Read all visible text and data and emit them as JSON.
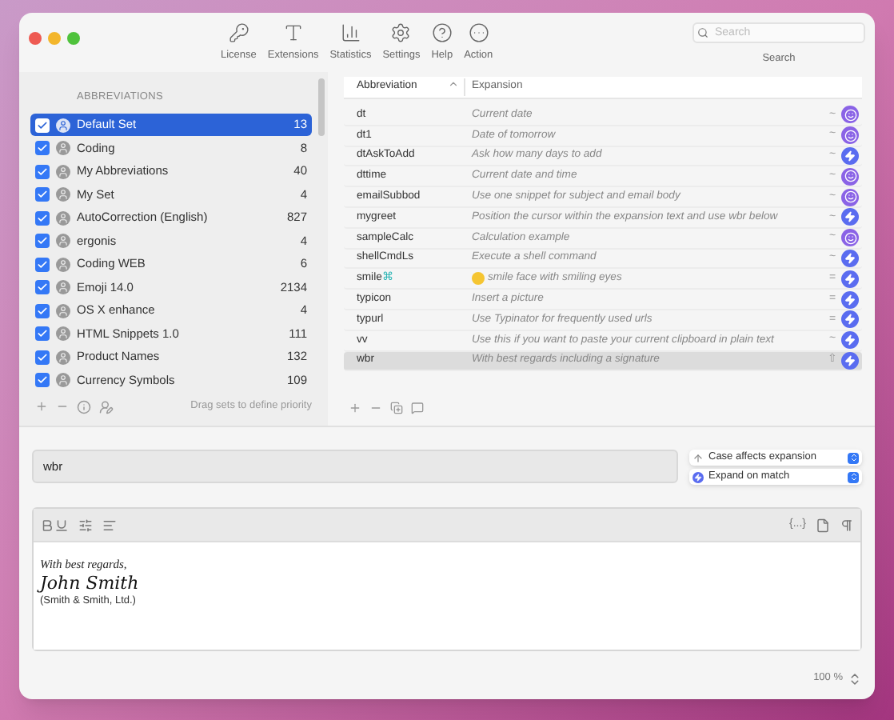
{
  "toolbar": [
    {
      "label": "License",
      "kind": "key"
    },
    {
      "label": "Extensions",
      "kind": "text"
    },
    {
      "label": "Statistics",
      "kind": "chart"
    },
    {
      "label": "Settings",
      "kind": "gear"
    },
    {
      "label": "Help",
      "kind": "help"
    },
    {
      "label": "Action",
      "kind": "action"
    }
  ],
  "search": {
    "placeholder": "Search",
    "label": "Search"
  },
  "sets": {
    "header": "ABBREVIATIONS",
    "items": [
      {
        "name": "Default Set",
        "count": "13",
        "checked": true,
        "selected": true
      },
      {
        "name": "Coding",
        "count": "8",
        "checked": true,
        "selected": false
      },
      {
        "name": "My Abbreviations",
        "count": "40",
        "checked": true,
        "selected": false
      },
      {
        "name": "My Set",
        "count": "4",
        "checked": true,
        "selected": false
      },
      {
        "name": "AutoCorrection (English)",
        "count": "827",
        "checked": true,
        "selected": false
      },
      {
        "name": "ergonis",
        "count": "4",
        "checked": true,
        "selected": false
      },
      {
        "name": "Coding WEB",
        "count": "6",
        "checked": true,
        "selected": false
      },
      {
        "name": "Emoji 14.0",
        "count": "2134",
        "checked": true,
        "selected": false
      },
      {
        "name": "OS X enhance",
        "count": "4",
        "checked": true,
        "selected": false
      },
      {
        "name": "HTML Snippets 1.0",
        "count": "111",
        "checked": true,
        "selected": false
      },
      {
        "name": "Product Names",
        "count": "132",
        "checked": true,
        "selected": false
      },
      {
        "name": "Currency Symbols",
        "count": "109",
        "checked": true,
        "selected": false
      }
    ],
    "hint": "Drag sets to define priority"
  },
  "table": {
    "columns": [
      "Abbreviation",
      "Expansion"
    ],
    "rows": [
      {
        "abbreviation": "dt",
        "expansion": "Current date",
        "mode": "~",
        "kind": "script",
        "selected": false
      },
      {
        "abbreviation": "dt1",
        "expansion": "Date of tomorrow",
        "mode": "~",
        "kind": "script",
        "selected": false
      },
      {
        "abbreviation": "dtAskToAdd",
        "expansion": "Ask how many days to add",
        "mode": "~",
        "kind": "bolt",
        "selected": false
      },
      {
        "abbreviation": "dttime",
        "expansion": "Current date and time",
        "mode": "~",
        "kind": "script",
        "selected": false
      },
      {
        "abbreviation": "emailSubbod",
        "expansion": "Use one snippet for subject and email body",
        "mode": "~",
        "kind": "script",
        "selected": false
      },
      {
        "abbreviation": "mygreet",
        "expansion": "Position the cursor within the expansion text and use wbr below",
        "mode": "~",
        "kind": "bolt",
        "selected": false
      },
      {
        "abbreviation": "sampleCalc",
        "expansion": "Calculation example",
        "mode": "~",
        "kind": "script",
        "selected": false
      },
      {
        "abbreviation": "shellCmdLs",
        "expansion": "Execute a shell command",
        "mode": "~",
        "kind": "bolt",
        "selected": false
      },
      {
        "abbreviation": "smile",
        "mark": "⌘",
        "emoji": true,
        "expansion": "smile face with smiling eyes",
        "mode": "=",
        "kind": "bolt",
        "selected": false
      },
      {
        "abbreviation": "typicon",
        "expansion": "Insert a picture",
        "mode": "=",
        "kind": "bolt",
        "selected": false
      },
      {
        "abbreviation": "typurl",
        "expansion": "Use Typinator for frequently used urls",
        "mode": "=",
        "kind": "bolt",
        "selected": false
      },
      {
        "abbreviation": "vv",
        "expansion": "Use this if you want to paste your current clipboard in plain text",
        "mode": "~",
        "kind": "bolt",
        "selected": false
      },
      {
        "abbreviation": "wbr",
        "expansion": "With best regards including a signature",
        "mode": "⇧",
        "kind": "bolt",
        "selected": true
      }
    ]
  },
  "abbreviation_field": {
    "value": "wbr"
  },
  "options": [
    {
      "label": "Case affects expansion",
      "kind": "case"
    },
    {
      "label": "Expand on match",
      "kind": "bolt"
    }
  ],
  "editor": {
    "braces": "{...}",
    "lines": [
      {
        "text": "With best regards,",
        "kind": "greeting"
      },
      {
        "text": "John Smith",
        "kind": "signature"
      },
      {
        "text": "(Smith & Smith, Ltd.)",
        "kind": "plain"
      }
    ]
  },
  "zoom": "100 %"
}
